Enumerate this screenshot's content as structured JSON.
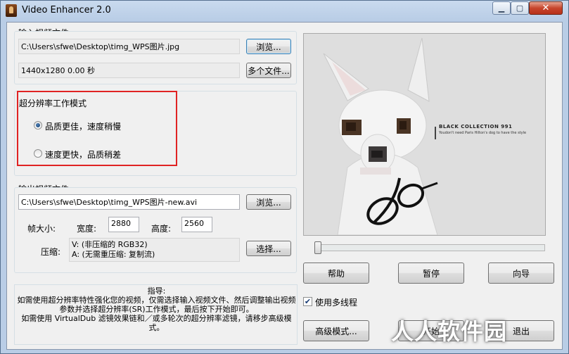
{
  "window": {
    "title": "Video Enhancer 2.0"
  },
  "input": {
    "group_label": "输入视频文件",
    "path": "C:\\Users\\sfwe\\Desktop\\timg_WPS图片.jpg",
    "info": "1440x1280 0.00 秒",
    "browse_label": "浏览...",
    "multi_label": "多个文件..."
  },
  "mode": {
    "group_label": "超分辨率工作模式",
    "option_quality": "品质更佳，速度稍慢",
    "option_speed": "速度更快，品质稍差",
    "selected": "quality"
  },
  "output": {
    "group_label": "输出视频文件",
    "path": "C:\\Users\\sfwe\\Desktop\\timg_WPS图片-new.avi",
    "browse_label": "浏览...",
    "frame_size_label": "帧大小:",
    "width_label": "宽度:",
    "width_value": "2880",
    "height_label": "高度:",
    "height_value": "2560",
    "compress_label": "压缩:",
    "compress_v": "V: (非压缩的 RGB32)",
    "compress_a": "A: (无需重压缩: 复制流)",
    "select_label": "选择..."
  },
  "guide": {
    "title": "指导:",
    "body": "如需使用超分辨率特性强化您的视频，仅需选择输入视频文件、然后调整输出视频参数并选择超分辨率(SR)工作模式，最后按下开始即可。\n如需使用 VirtualDub 滤镜效果链和／或多轮次的超分辨率滤镜，请移步高级模式。"
  },
  "preview": {
    "caption_main": "BLACK COLLECTION 991",
    "caption_sub": "Youdon't need Paris Hilton's dog to have the style"
  },
  "slider": {
    "position_percent": 0
  },
  "buttons": {
    "help": "帮助",
    "pause": "暂停",
    "wizard": "向导",
    "advanced": "高级模式...",
    "start": "开始",
    "exit": "退出"
  },
  "multithread": {
    "label": "使用多线程",
    "checked": true
  },
  "watermark": {
    "text": "人人软件园"
  },
  "colors": {
    "highlight": "#e02323",
    "accent": "#3c7fb1"
  }
}
